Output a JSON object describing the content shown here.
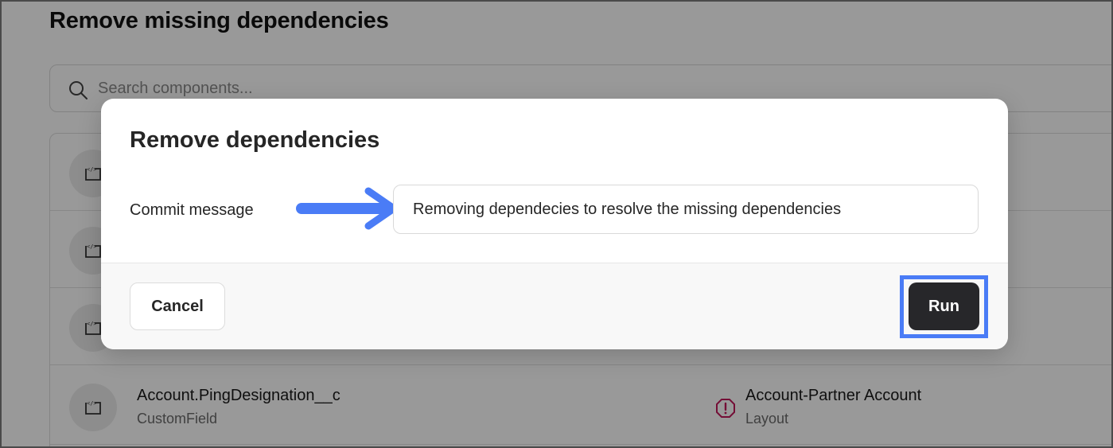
{
  "page": {
    "title": "Remove missing dependencies",
    "search_placeholder": "Search components..."
  },
  "components": [
    {
      "name": "",
      "type": ""
    },
    {
      "name": "",
      "type": ""
    },
    {
      "name": "",
      "type": ""
    },
    {
      "name": "Account.PingDesignation__c",
      "type": "CustomField",
      "dependency_name": "Account-Partner Account",
      "dependency_type": "Layout"
    }
  ],
  "modal": {
    "title": "Remove dependencies",
    "commit_label": "Commit message",
    "commit_value": "Removing dependecies to resolve the missing dependencies",
    "cancel_label": "Cancel",
    "run_label": "Run"
  },
  "colors": {
    "accent": "#4a7cf6",
    "run_button": "#27272a",
    "warning": "#c2185b"
  }
}
